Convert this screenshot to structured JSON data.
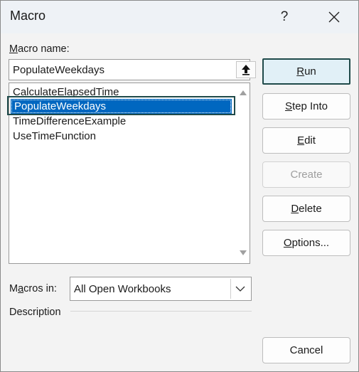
{
  "window": {
    "title": "Macro",
    "help_label": "?"
  },
  "macro_name": {
    "label_first": "M",
    "label_rest": "acro name:",
    "value": "PopulateWeekdays"
  },
  "macro_list": {
    "items": [
      {
        "label": "CalculateElapsedTime",
        "selected": false
      },
      {
        "label": "PopulateWeekdays",
        "selected": true
      },
      {
        "label": "TimeDifferenceExample",
        "selected": false
      },
      {
        "label": "UseTimeFunction",
        "selected": false
      }
    ]
  },
  "buttons": {
    "run": {
      "pre": "",
      "key": "R",
      "post": "un"
    },
    "step_into": {
      "pre": "",
      "key": "S",
      "post": "tep Into"
    },
    "edit": {
      "pre": "",
      "key": "E",
      "post": "dit"
    },
    "create": {
      "label": "Create"
    },
    "delete": {
      "pre": "",
      "key": "D",
      "post": "elete"
    },
    "options": {
      "pre": "",
      "key": "O",
      "post": "ptions..."
    },
    "cancel": {
      "label": "Cancel"
    }
  },
  "macros_in": {
    "label_pre": "M",
    "label_key": "a",
    "label_post": "cros in:",
    "selected": "All Open Workbooks"
  },
  "description": {
    "label": "Description"
  },
  "colors": {
    "selection": "#0067c0",
    "focus_border": "#1f4a4a",
    "primary_button_bg": "#e1f0f7"
  },
  "icons": {
    "close": "close-icon",
    "upload": "upload-arrow-icon",
    "scroll_up": "triangle-up-icon",
    "scroll_down": "triangle-down-icon",
    "dropdown": "chevron-down-icon"
  }
}
